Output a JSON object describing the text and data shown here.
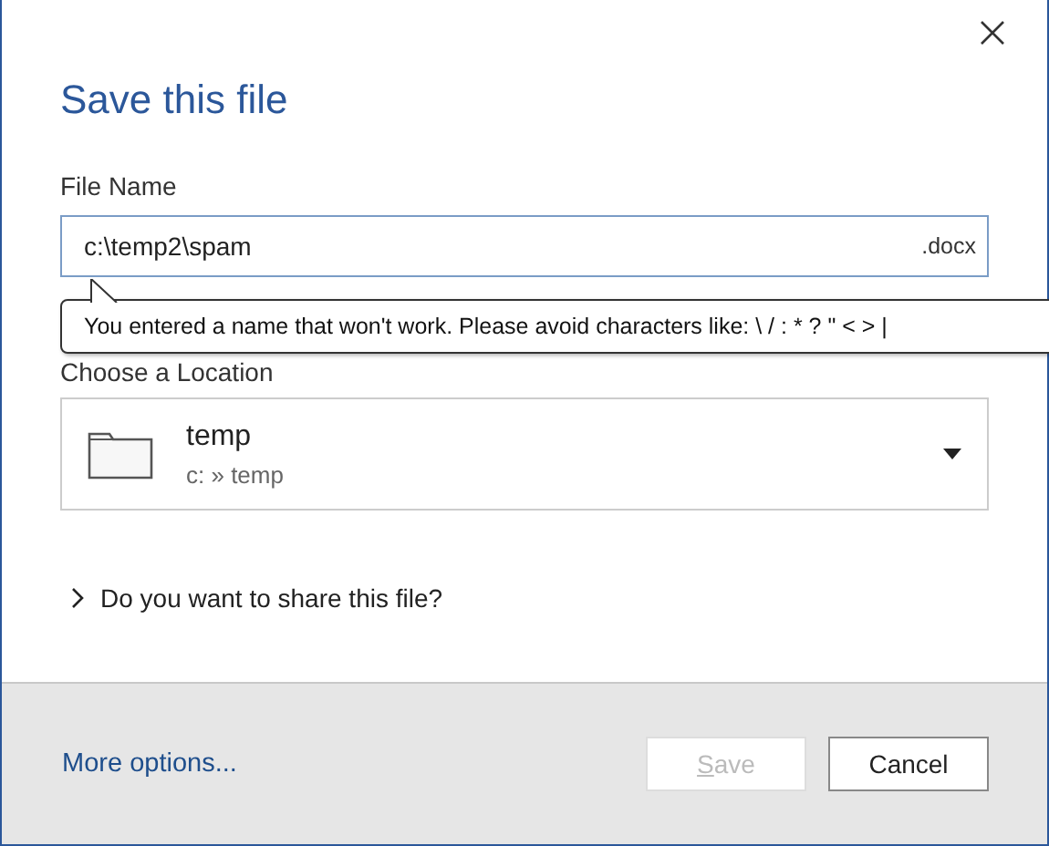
{
  "dialog": {
    "title": "Save this file"
  },
  "file_name": {
    "label": "File Name",
    "value": "c:\\temp2\\spam",
    "extension": ".docx"
  },
  "tooltip": {
    "text": "You entered a name that won't work. Please avoid characters like: \\ / : * ? \" < > |"
  },
  "location": {
    "label": "Choose a Location",
    "folder": "temp",
    "path": "c: » temp"
  },
  "share": {
    "label": "Do you want to share this file?",
    "expanded": false
  },
  "footer": {
    "link": "More options...",
    "buttons": [
      {
        "label": "Save",
        "disabled": true
      },
      {
        "label": "Cancel",
        "disabled": false
      }
    ]
  }
}
